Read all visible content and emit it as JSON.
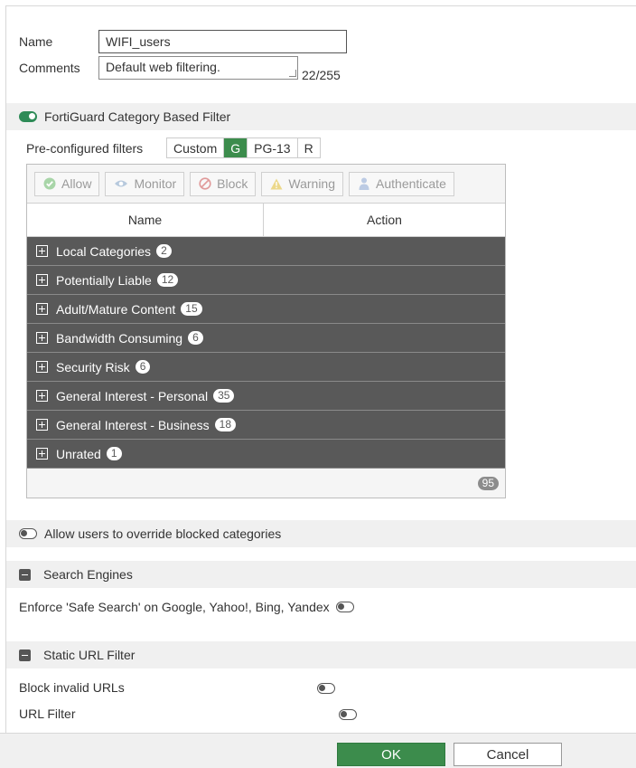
{
  "form": {
    "name_label": "Name",
    "name_value": "WIFI_users",
    "comments_label": "Comments",
    "comments_value": "Default web filtering.",
    "comments_counter": "22/255"
  },
  "fortiguard": {
    "title": "FortiGuard Category Based Filter",
    "enabled": true,
    "preconfigured_label": "Pre-configured filters",
    "presets": [
      "Custom",
      "G",
      "PG-13",
      "R"
    ],
    "active_preset": "G",
    "actions": [
      "Allow",
      "Monitor",
      "Block",
      "Warning",
      "Authenticate"
    ],
    "columns": [
      "Name",
      "Action"
    ],
    "categories": [
      {
        "name": "Local Categories",
        "count": "2"
      },
      {
        "name": "Potentially Liable",
        "count": "12"
      },
      {
        "name": "Adult/Mature Content",
        "count": "15"
      },
      {
        "name": "Bandwidth Consuming",
        "count": "6"
      },
      {
        "name": "Security Risk",
        "count": "6"
      },
      {
        "name": "General Interest - Personal",
        "count": "35"
      },
      {
        "name": "General Interest - Business",
        "count": "18"
      },
      {
        "name": "Unrated",
        "count": "1"
      }
    ],
    "total": "95"
  },
  "override": {
    "label": "Allow users to override blocked categories",
    "enabled": false
  },
  "search_engines": {
    "title": "Search Engines",
    "safe_search_label": "Enforce 'Safe Search' on Google, Yahoo!, Bing, Yandex",
    "safe_search_enabled": false
  },
  "static_url": {
    "title": "Static URL Filter",
    "block_invalid_label": "Block invalid URLs",
    "url_filter_label": "URL Filter"
  },
  "footer": {
    "ok_label": "OK",
    "cancel_label": "Cancel"
  },
  "colors": {
    "accent": "#3c8c4c",
    "category_row": "#595959"
  }
}
